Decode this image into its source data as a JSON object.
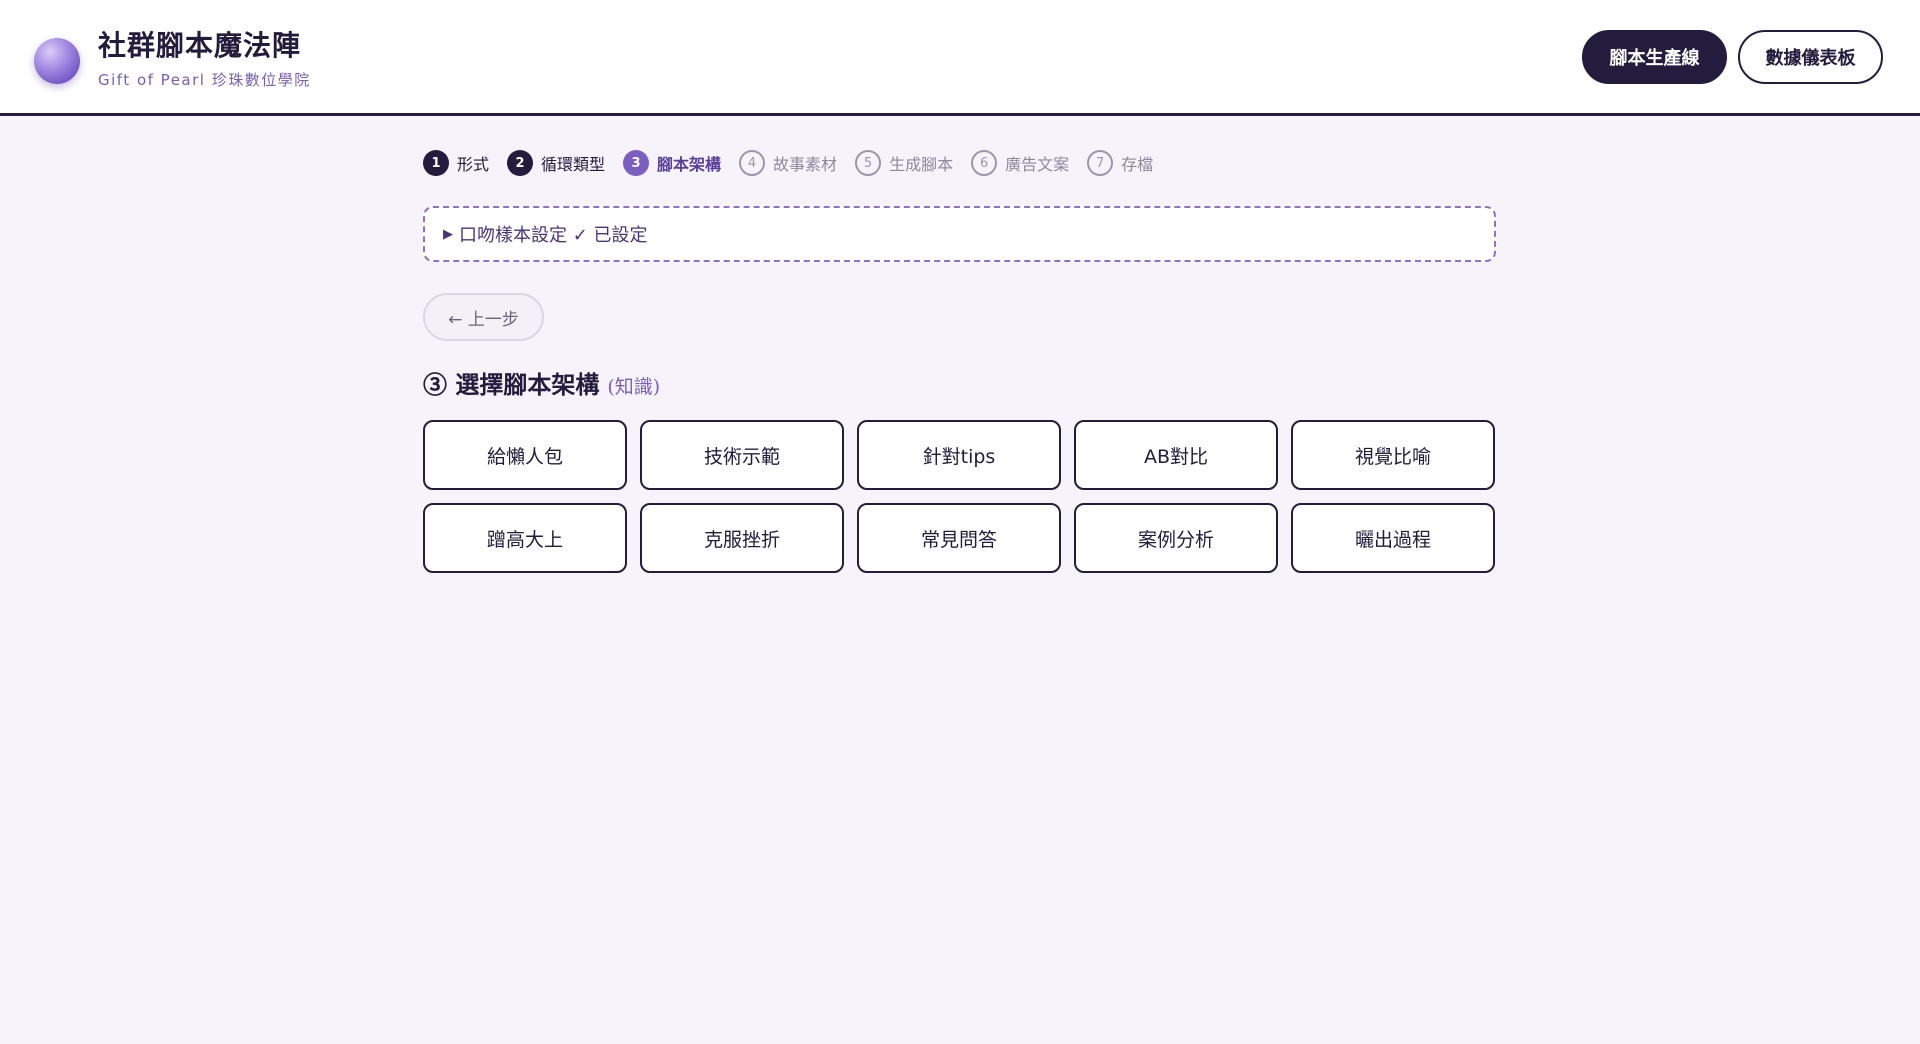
{
  "header": {
    "title": "社群腳本魔法陣",
    "subtitle": "Gift of Pearl 珍珠數位學院",
    "logo_icon": "pearl-icon",
    "nav": [
      {
        "label": "腳本生產線",
        "active": true
      },
      {
        "label": "數據儀表板",
        "active": false
      }
    ]
  },
  "stepper": {
    "steps": [
      {
        "num": "1",
        "label": "形式",
        "state": "done"
      },
      {
        "num": "2",
        "label": "循環類型",
        "state": "done"
      },
      {
        "num": "3",
        "label": "腳本架構",
        "state": "current"
      },
      {
        "num": "4",
        "label": "故事素材",
        "state": "pending"
      },
      {
        "num": "5",
        "label": "生成腳本",
        "state": "pending"
      },
      {
        "num": "6",
        "label": "廣告文案",
        "state": "pending"
      },
      {
        "num": "7",
        "label": "存檔",
        "state": "pending"
      }
    ]
  },
  "voice_settings": {
    "toggle_icon": "▶",
    "label": "口吻樣本設定 ✓ 已設定"
  },
  "back_button": {
    "label": "← 上一步"
  },
  "section": {
    "title": "③ 選擇腳本架構",
    "tag": "(知識)"
  },
  "options": [
    "給懶人包",
    "技術示範",
    "針對tips",
    "AB對比",
    "視覺比喻",
    "蹭高大上",
    "克服挫折",
    "常見問答",
    "案例分析",
    "曬出過程"
  ],
  "colors": {
    "primary_dark": "#231c3d",
    "accent_purple": "#7b5fc0",
    "background": "#f6f3fa"
  }
}
